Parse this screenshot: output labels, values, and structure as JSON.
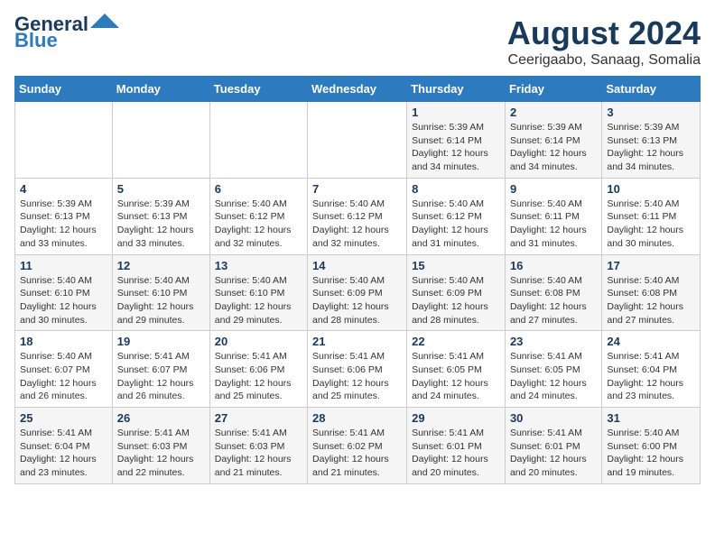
{
  "header": {
    "logo_line1": "General",
    "logo_line2": "Blue",
    "main_title": "August 2024",
    "subtitle": "Ceerigaabo, Sanaag, Somalia"
  },
  "calendar": {
    "days_of_week": [
      "Sunday",
      "Monday",
      "Tuesday",
      "Wednesday",
      "Thursday",
      "Friday",
      "Saturday"
    ],
    "weeks": [
      [
        {
          "day": "",
          "info": ""
        },
        {
          "day": "",
          "info": ""
        },
        {
          "day": "",
          "info": ""
        },
        {
          "day": "",
          "info": ""
        },
        {
          "day": "1",
          "info": "Sunrise: 5:39 AM\nSunset: 6:14 PM\nDaylight: 12 hours\nand 34 minutes."
        },
        {
          "day": "2",
          "info": "Sunrise: 5:39 AM\nSunset: 6:14 PM\nDaylight: 12 hours\nand 34 minutes."
        },
        {
          "day": "3",
          "info": "Sunrise: 5:39 AM\nSunset: 6:13 PM\nDaylight: 12 hours\nand 34 minutes."
        }
      ],
      [
        {
          "day": "4",
          "info": "Sunrise: 5:39 AM\nSunset: 6:13 PM\nDaylight: 12 hours\nand 33 minutes."
        },
        {
          "day": "5",
          "info": "Sunrise: 5:39 AM\nSunset: 6:13 PM\nDaylight: 12 hours\nand 33 minutes."
        },
        {
          "day": "6",
          "info": "Sunrise: 5:40 AM\nSunset: 6:12 PM\nDaylight: 12 hours\nand 32 minutes."
        },
        {
          "day": "7",
          "info": "Sunrise: 5:40 AM\nSunset: 6:12 PM\nDaylight: 12 hours\nand 32 minutes."
        },
        {
          "day": "8",
          "info": "Sunrise: 5:40 AM\nSunset: 6:12 PM\nDaylight: 12 hours\nand 31 minutes."
        },
        {
          "day": "9",
          "info": "Sunrise: 5:40 AM\nSunset: 6:11 PM\nDaylight: 12 hours\nand 31 minutes."
        },
        {
          "day": "10",
          "info": "Sunrise: 5:40 AM\nSunset: 6:11 PM\nDaylight: 12 hours\nand 30 minutes."
        }
      ],
      [
        {
          "day": "11",
          "info": "Sunrise: 5:40 AM\nSunset: 6:10 PM\nDaylight: 12 hours\nand 30 minutes."
        },
        {
          "day": "12",
          "info": "Sunrise: 5:40 AM\nSunset: 6:10 PM\nDaylight: 12 hours\nand 29 minutes."
        },
        {
          "day": "13",
          "info": "Sunrise: 5:40 AM\nSunset: 6:10 PM\nDaylight: 12 hours\nand 29 minutes."
        },
        {
          "day": "14",
          "info": "Sunrise: 5:40 AM\nSunset: 6:09 PM\nDaylight: 12 hours\nand 28 minutes."
        },
        {
          "day": "15",
          "info": "Sunrise: 5:40 AM\nSunset: 6:09 PM\nDaylight: 12 hours\nand 28 minutes."
        },
        {
          "day": "16",
          "info": "Sunrise: 5:40 AM\nSunset: 6:08 PM\nDaylight: 12 hours\nand 27 minutes."
        },
        {
          "day": "17",
          "info": "Sunrise: 5:40 AM\nSunset: 6:08 PM\nDaylight: 12 hours\nand 27 minutes."
        }
      ],
      [
        {
          "day": "18",
          "info": "Sunrise: 5:40 AM\nSunset: 6:07 PM\nDaylight: 12 hours\nand 26 minutes."
        },
        {
          "day": "19",
          "info": "Sunrise: 5:41 AM\nSunset: 6:07 PM\nDaylight: 12 hours\nand 26 minutes."
        },
        {
          "day": "20",
          "info": "Sunrise: 5:41 AM\nSunset: 6:06 PM\nDaylight: 12 hours\nand 25 minutes."
        },
        {
          "day": "21",
          "info": "Sunrise: 5:41 AM\nSunset: 6:06 PM\nDaylight: 12 hours\nand 25 minutes."
        },
        {
          "day": "22",
          "info": "Sunrise: 5:41 AM\nSunset: 6:05 PM\nDaylight: 12 hours\nand 24 minutes."
        },
        {
          "day": "23",
          "info": "Sunrise: 5:41 AM\nSunset: 6:05 PM\nDaylight: 12 hours\nand 24 minutes."
        },
        {
          "day": "24",
          "info": "Sunrise: 5:41 AM\nSunset: 6:04 PM\nDaylight: 12 hours\nand 23 minutes."
        }
      ],
      [
        {
          "day": "25",
          "info": "Sunrise: 5:41 AM\nSunset: 6:04 PM\nDaylight: 12 hours\nand 23 minutes."
        },
        {
          "day": "26",
          "info": "Sunrise: 5:41 AM\nSunset: 6:03 PM\nDaylight: 12 hours\nand 22 minutes."
        },
        {
          "day": "27",
          "info": "Sunrise: 5:41 AM\nSunset: 6:03 PM\nDaylight: 12 hours\nand 21 minutes."
        },
        {
          "day": "28",
          "info": "Sunrise: 5:41 AM\nSunset: 6:02 PM\nDaylight: 12 hours\nand 21 minutes."
        },
        {
          "day": "29",
          "info": "Sunrise: 5:41 AM\nSunset: 6:01 PM\nDaylight: 12 hours\nand 20 minutes."
        },
        {
          "day": "30",
          "info": "Sunrise: 5:41 AM\nSunset: 6:01 PM\nDaylight: 12 hours\nand 20 minutes."
        },
        {
          "day": "31",
          "info": "Sunrise: 5:40 AM\nSunset: 6:00 PM\nDaylight: 12 hours\nand 19 minutes."
        }
      ]
    ]
  }
}
